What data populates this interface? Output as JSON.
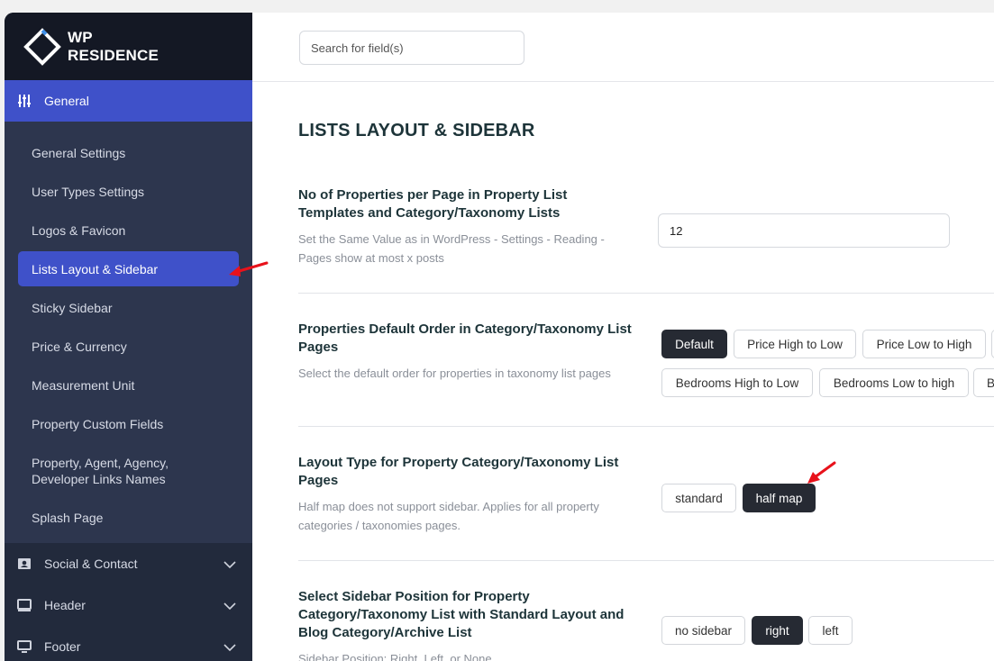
{
  "brand": {
    "line1": "WP",
    "line2": "RESIDENCE"
  },
  "sidebar": {
    "general_label": "General",
    "sub_items": [
      "General Settings",
      "User Types Settings",
      "Logos & Favicon",
      "Lists Layout & Sidebar",
      "Sticky Sidebar",
      "Price & Currency",
      "Measurement Unit",
      "Property Custom Fields",
      "Property, Agent, Agency, Developer Links Names",
      "Splash Page"
    ],
    "active_index": 3,
    "groups": [
      "Social & Contact",
      "Header",
      "Footer"
    ]
  },
  "search": {
    "placeholder": "Search for field(s)"
  },
  "page_title": "LISTS LAYOUT & SIDEBAR",
  "settings": {
    "per_page": {
      "label": "No of Properties per Page in Property List Templates and Category/Taxonomy Lists",
      "desc": "Set the Same Value as in WordPress - Settings - Reading - Pages show at most x posts",
      "value": "12"
    },
    "default_order": {
      "label": "Properties Default Order in Category/Taxonomy List Pages",
      "desc": "Select the default order for properties in taxonomy list pages",
      "options": [
        "Default",
        "Price High to Low",
        "Price Low to High",
        "Bedrooms High to Low",
        "Bedrooms Low to high"
      ],
      "selected": "Default"
    },
    "layout_type": {
      "label": "Layout Type for Property Category/Taxonomy List Pages",
      "desc": "Half map does not support sidebar. Applies for all property categories / taxonomies pages.",
      "options": [
        "standard",
        "half map"
      ],
      "selected": "half map"
    },
    "sidebar_position": {
      "label": "Select Sidebar Position for Property Category/Taxonomy List with Standard Layout and Blog Category/Archive List",
      "desc": "Sidebar Position: Right, Left, or None",
      "options": [
        "no sidebar",
        "right",
        "left"
      ],
      "selected": "right"
    }
  },
  "colors": {
    "accent": "#3f51c9",
    "annotation_arrow": "#e8121b",
    "selected_button": "#262a33"
  }
}
